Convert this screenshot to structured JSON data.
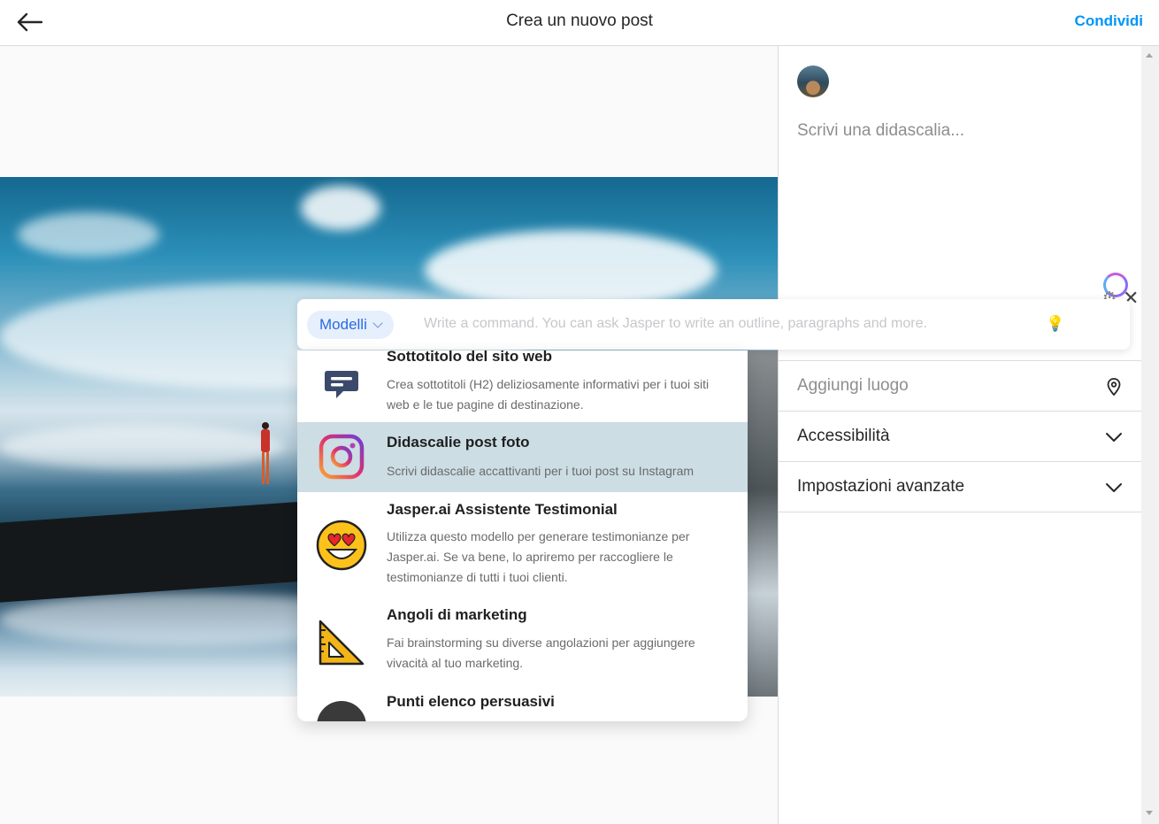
{
  "header": {
    "title": "Crea un nuovo post",
    "share_label": "Condividi"
  },
  "caption": {
    "placeholder": "Scrivi una didascalia..."
  },
  "options": {
    "location_label": "Aggiungi luogo",
    "accessibility_label": "Accessibilità",
    "advanced_label": "Impostazioni avanzate"
  },
  "jasper": {
    "models_label": "Modelli",
    "command_placeholder": "Write a command. You can ask Jasper to write an outline, paragraphs and more.",
    "templates": [
      {
        "title": "Sottotitolo del sito web",
        "description": "Crea sottotitoli (H2) deliziosamente informativi per i tuoi siti web e le tue pagine di destinazione.",
        "icon": "speech-bubble-icon",
        "selected": false
      },
      {
        "title": "Didascalie post foto",
        "description": "Scrivi didascalie accattivanti per i tuoi post su Instagram",
        "icon": "instagram-icon",
        "selected": true
      },
      {
        "title": "Jasper.ai Assistente Testimonial",
        "description": "Utilizza questo modello per generare testimonianze per Jasper.ai. Se va bene, lo apriremo per raccogliere le testimonianze di tutti i tuoi clienti.",
        "icon": "heart-eyes-emoji-icon",
        "selected": false
      },
      {
        "title": "Angoli di marketing",
        "description": "Fai brainstorming su diverse angolazioni per aggiungere vivacità al tuo marketing.",
        "icon": "set-square-icon",
        "selected": false
      },
      {
        "title": "Punti elenco persuasivi",
        "description": "",
        "icon": "bullet-icon",
        "selected": false
      }
    ]
  },
  "colors": {
    "accent_blue": "#0095f6",
    "jasper_blue": "#2c6ce0",
    "selected_row": "#ccdde4"
  }
}
